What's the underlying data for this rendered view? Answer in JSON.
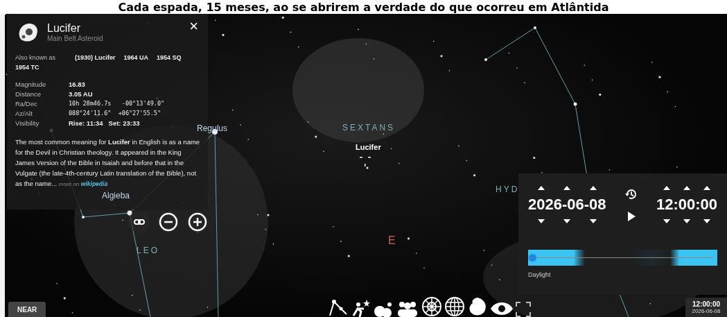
{
  "caption": "Cada espada, 15 meses, ao se abrirem a verdade do que ocorreu em Atlântida",
  "info_panel": {
    "title": "Lucifer",
    "subtitle": "Main Belt Asteroid",
    "aliases_label": "Also known as",
    "aliases": [
      "(1930) Lucifer",
      "1964 UA",
      "1954 SQ",
      "1954 TC"
    ],
    "properties": [
      {
        "label": "Magnitude",
        "value": "16.83",
        "kind": "plain"
      },
      {
        "label": "Distance",
        "value": "3.05 AU",
        "kind": "plain"
      },
      {
        "label": "Ra/Dec",
        "value": "10h 28m46.7s   -00°13'49.0\"",
        "kind": "mono"
      },
      {
        "label": "Az/Alt",
        "value": "088°24'11.6\"  +06°27'55.5\"",
        "kind": "mono"
      },
      {
        "label": "Visibility",
        "value": "Rise: 11:34   Set: 23:33",
        "kind": "plain"
      }
    ],
    "description": "The most common meaning for **Lucifer** in English is as a name for the Devil in Christian theology. It appeared in the King James Version of the Bible in Isaiah and before that in the Vulgate (the late-4th-century Latin translation of the Bible), not as the name...",
    "more_label": "more on",
    "link": "wikipedia",
    "close": "×"
  },
  "sky_labels": [
    {
      "text": "Regulus",
      "kind": "star"
    },
    {
      "text": "SEXTANS",
      "kind": "constellation"
    },
    {
      "text": "Lucifer",
      "kind": "object"
    },
    {
      "text": "Algieba",
      "kind": "star"
    },
    {
      "text": "LEO",
      "kind": "constellation"
    },
    {
      "text": "HYD",
      "kind": "constellation"
    },
    {
      "text": "E",
      "kind": "cardinal"
    }
  ],
  "time_panel": {
    "date": "2026-06-08",
    "time": "12:00:00",
    "slider_label": "Daylight",
    "level": 0.0
  },
  "near_button": "NEAR",
  "clock": {
    "time": "12:00:00",
    "date": "2026-06-08"
  }
}
